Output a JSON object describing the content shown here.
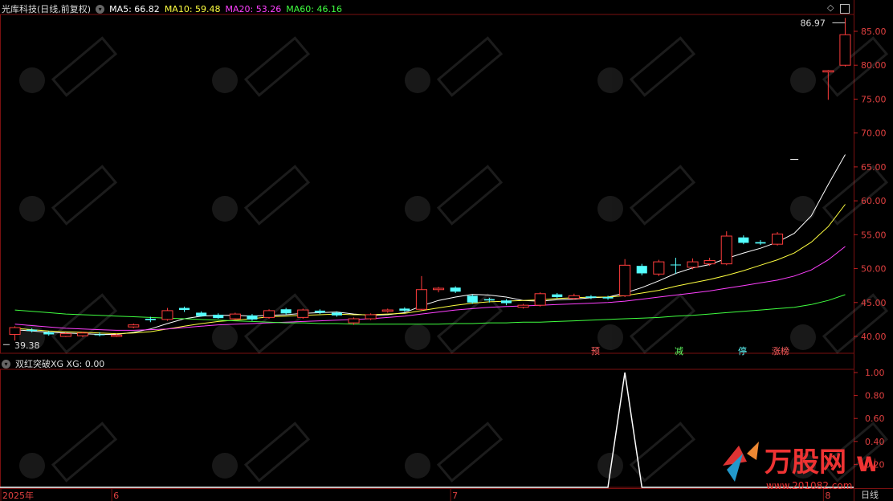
{
  "title": "光库科技(日线,前复权)",
  "ma_legend": [
    {
      "label": "MA5: 66.82",
      "color": "#ffffff"
    },
    {
      "label": "MA10: 59.48",
      "color": "#ffff40"
    },
    {
      "label": "MA20: 53.26",
      "color": "#ff40ff"
    },
    {
      "label": "MA60: 46.16",
      "color": "#40ff40"
    }
  ],
  "indicator_title": "双红突破XG XG: 0.00",
  "period": "日线",
  "signals": [
    {
      "label": "预",
      "color": "#ff6060"
    },
    {
      "label": "减",
      "color": "#60ff60"
    },
    {
      "label": "停",
      "color": "#60ffff"
    },
    {
      "label": "涨榜",
      "color": "#ff6060"
    }
  ],
  "annotations": {
    "high_label": "86.97",
    "low_label": "39.38"
  },
  "watermark": "万股网 www.201082.com",
  "chart_data": [
    {
      "type": "candlestick",
      "title": "光库科技(日线,前复权)",
      "x_labels": [
        "2025年",
        "6",
        "7",
        "8"
      ],
      "y_ticks": [
        "85.00",
        "80.00",
        "75.00",
        "70.00",
        "65.00",
        "60.00",
        "55.00",
        "50.00",
        "45.00",
        "40.00"
      ],
      "ylim": [
        38.0,
        88.0
      ],
      "candles": [
        [
          40.3,
          41.3,
          39.4,
          41.5
        ],
        [
          41.0,
          40.8,
          40.6,
          41.2
        ],
        [
          40.6,
          40.3,
          40.1,
          40.8
        ],
        [
          40.0,
          40.4,
          39.9,
          40.6
        ],
        [
          40.1,
          40.5,
          39.9,
          40.7
        ],
        [
          40.3,
          40.2,
          40.0,
          40.6
        ],
        [
          40.0,
          40.2,
          39.9,
          40.4
        ],
        [
          41.4,
          41.7,
          41.2,
          41.9
        ],
        [
          42.6,
          42.4,
          42.1,
          42.9
        ],
        [
          42.5,
          43.8,
          42.3,
          44.2
        ],
        [
          44.2,
          43.9,
          43.6,
          44.4
        ],
        [
          43.5,
          43.0,
          42.9,
          43.7
        ],
        [
          43.2,
          42.7,
          42.6,
          43.4
        ],
        [
          42.6,
          43.3,
          42.4,
          43.5
        ],
        [
          43.1,
          42.5,
          42.3,
          43.3
        ],
        [
          42.8,
          43.8,
          42.6,
          44.0
        ],
        [
          44.0,
          43.4,
          43.2,
          44.2
        ],
        [
          42.8,
          43.9,
          42.6,
          44.1
        ],
        [
          43.8,
          43.5,
          43.3,
          44.0
        ],
        [
          43.5,
          43.1,
          42.9,
          43.7
        ],
        [
          42.0,
          42.6,
          41.7,
          42.8
        ],
        [
          42.6,
          43.2,
          42.4,
          43.4
        ],
        [
          43.7,
          43.9,
          43.5,
          44.1
        ],
        [
          44.1,
          43.8,
          43.6,
          44.3
        ],
        [
          44.0,
          46.9,
          43.8,
          48.9
        ],
        [
          46.9,
          47.1,
          46.5,
          47.3
        ],
        [
          47.2,
          46.6,
          46.4,
          47.4
        ],
        [
          46.0,
          45.0,
          44.8,
          46.2
        ],
        [
          45.5,
          45.3,
          45.0,
          45.7
        ],
        [
          45.3,
          44.9,
          44.6,
          45.5
        ],
        [
          44.3,
          44.6,
          44.1,
          44.8
        ],
        [
          44.6,
          46.3,
          44.4,
          46.5
        ],
        [
          46.2,
          45.8,
          45.6,
          46.4
        ],
        [
          45.6,
          46.0,
          45.4,
          46.3
        ],
        [
          45.9,
          45.7,
          45.5,
          46.1
        ],
        [
          45.8,
          45.6,
          45.4,
          46.0
        ],
        [
          46.0,
          50.5,
          45.8,
          51.4
        ],
        [
          50.4,
          49.3,
          49.0,
          50.7
        ],
        [
          49.2,
          51.0,
          48.9,
          51.3
        ],
        [
          50.6,
          50.5,
          49.2,
          51.6
        ],
        [
          50.2,
          51.0,
          49.9,
          51.5
        ],
        [
          50.7,
          51.2,
          50.4,
          51.6
        ],
        [
          50.7,
          54.8,
          50.5,
          55.5
        ],
        [
          54.6,
          53.8,
          53.6,
          54.9
        ],
        [
          53.9,
          53.7,
          53.5,
          54.2
        ],
        [
          53.6,
          55.1,
          53.4,
          55.4
        ],
        [
          null,
          null,
          null,
          null
        ],
        [
          null,
          null,
          null,
          null
        ],
        [
          79.0,
          79.2,
          74.9,
          79.3
        ],
        [
          80.0,
          84.5,
          79.8,
          86.97
        ]
      ],
      "series": [
        {
          "name": "MA5",
          "color": "#ffffff",
          "values": [
            41.0,
            40.8,
            40.6,
            40.5,
            40.4,
            40.3,
            40.3,
            40.6,
            41.1,
            41.9,
            42.6,
            43.0,
            43.1,
            43.1,
            43.0,
            43.1,
            43.2,
            43.4,
            43.5,
            43.6,
            43.3,
            43.1,
            43.2,
            43.5,
            44.5,
            45.3,
            45.8,
            46.2,
            46.1,
            45.8,
            45.3,
            45.2,
            45.4,
            45.5,
            45.7,
            45.8,
            46.4,
            47.2,
            48.2,
            49.3,
            50.1,
            50.6,
            51.5,
            52.3,
            53.0,
            53.9,
            55.2,
            57.8,
            62.4,
            66.82
          ]
        },
        {
          "name": "MA10",
          "color": "#ffff40",
          "values": [
            41.2,
            41.0,
            40.8,
            40.7,
            40.6,
            40.5,
            40.4,
            40.5,
            40.7,
            41.1,
            41.5,
            41.9,
            42.2,
            42.4,
            42.6,
            42.9,
            43.0,
            43.1,
            43.2,
            43.3,
            43.2,
            43.2,
            43.3,
            43.4,
            43.8,
            44.2,
            44.6,
            44.9,
            45.1,
            45.2,
            45.3,
            45.4,
            45.6,
            45.7,
            45.8,
            45.8,
            46.0,
            46.4,
            46.8,
            47.4,
            47.9,
            48.4,
            49.0,
            49.7,
            50.5,
            51.3,
            52.3,
            53.9,
            56.2,
            59.48
          ]
        },
        {
          "name": "MA20",
          "color": "#ff40ff",
          "values": [
            41.8,
            41.6,
            41.4,
            41.2,
            41.1,
            41.0,
            40.9,
            40.9,
            41.0,
            41.1,
            41.3,
            41.5,
            41.7,
            41.8,
            41.9,
            42.0,
            42.1,
            42.2,
            42.3,
            42.4,
            42.5,
            42.6,
            42.8,
            43.0,
            43.3,
            43.6,
            43.9,
            44.1,
            44.3,
            44.4,
            44.5,
            44.6,
            44.7,
            44.8,
            44.9,
            45.0,
            45.2,
            45.5,
            45.8,
            46.1,
            46.4,
            46.7,
            47.1,
            47.5,
            47.9,
            48.3,
            48.9,
            49.8,
            51.3,
            53.26
          ]
        },
        {
          "name": "MA60",
          "color": "#40ff40",
          "values": [
            43.9,
            43.7,
            43.5,
            43.3,
            43.2,
            43.1,
            43.0,
            42.9,
            42.8,
            42.7,
            42.6,
            42.5,
            42.4,
            42.3,
            42.2,
            42.1,
            42.0,
            42.0,
            41.9,
            41.9,
            41.8,
            41.8,
            41.8,
            41.8,
            41.8,
            41.8,
            41.9,
            41.9,
            42.0,
            42.0,
            42.1,
            42.1,
            42.2,
            42.3,
            42.4,
            42.5,
            42.6,
            42.7,
            42.8,
            43.0,
            43.1,
            43.3,
            43.5,
            43.7,
            43.9,
            44.1,
            44.3,
            44.7,
            45.3,
            46.16
          ]
        }
      ]
    },
    {
      "type": "line",
      "title": "双红突破XG XG: 0.00",
      "y_ticks": [
        "1.00",
        "0.80",
        "0.60",
        "0.40",
        "0.20"
      ],
      "ylim": [
        0,
        1.06
      ],
      "series": [
        {
          "name": "XG",
          "color": "#ffffff",
          "values": [
            0,
            0,
            0,
            0,
            0,
            0,
            0,
            0,
            0,
            0,
            0,
            0,
            0,
            0,
            0,
            0,
            0,
            0,
            0,
            0,
            0,
            0,
            0,
            0,
            0,
            0,
            0,
            0,
            0,
            0,
            0,
            0,
            0,
            0,
            0,
            0,
            1,
            0,
            0,
            0,
            0,
            0,
            0,
            0,
            0,
            0,
            0,
            0,
            0,
            0
          ]
        }
      ]
    }
  ]
}
